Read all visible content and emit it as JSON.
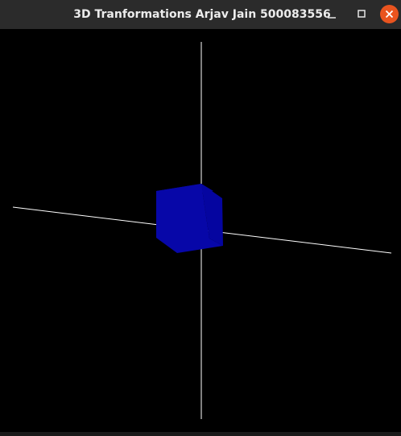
{
  "window": {
    "title": "3D Tranformations Arjav Jain 500083556"
  },
  "controls": {
    "minimize_icon": "minimize-icon",
    "maximize_icon": "maximize-icon",
    "close_icon": "close-icon",
    "close_color": "#e9541f"
  },
  "scene": {
    "background_color": "#000000",
    "axis_color": "#ffffff",
    "cube_color": "#0707a8"
  }
}
